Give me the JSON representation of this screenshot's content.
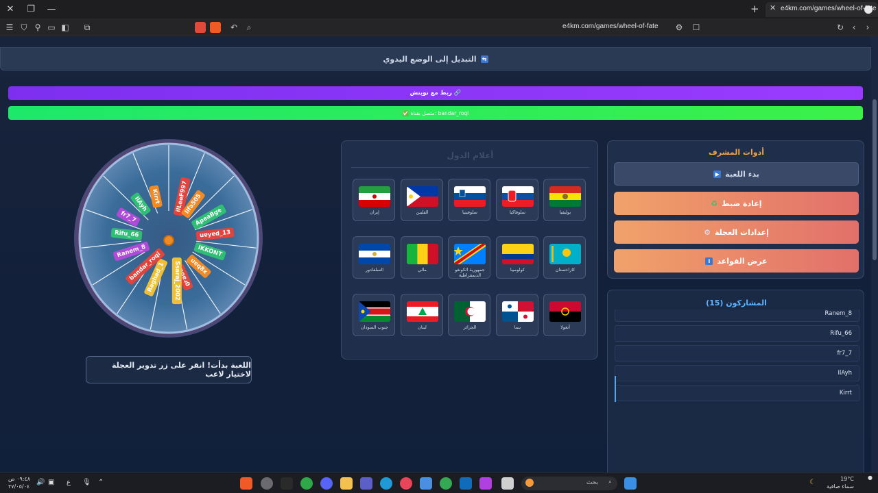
{
  "browser": {
    "tab_title": "e4km.com/games/wheel-of-fate",
    "url": "e4km.com/games/wheel-of-fate"
  },
  "page": {
    "manual_mode_label": "التبديل إلى الوضع اليدوي",
    "twitch_label": "ربط مع تويتش 🔗",
    "connected_label": "✅ متصل بقناة: bandar_roqi",
    "status_text": "اللعبة بدأت! انقر على زر تدوير العجلة لاختيار لاعب"
  },
  "wheel": {
    "names": [
      "ilLeeF997",
      "Ilfa505",
      "ApeaBge",
      "uɐyɐd_13",
      "IKKONT",
      "uɐq8x",
      "noɐɹ0",
      "Ssaraj_2002",
      "Raghad_1",
      "bandar_roqi",
      "Ranem_8",
      "Rifu_66",
      "fr7_7",
      "IlAyh",
      "Kirrt"
    ],
    "center_color": "#f08a24"
  },
  "flags": {
    "title": "أعلام الدول",
    "items": [
      {
        "name": "بوليفيا"
      },
      {
        "name": "سلوفاكيا"
      },
      {
        "name": "سلوفينيا"
      },
      {
        "name": "الفلبين"
      },
      {
        "name": "إيران"
      },
      {
        "name": "كازاخستان"
      },
      {
        "name": "كولومبيا"
      },
      {
        "name": "جمهورية الكونغو الديمقراطية"
      },
      {
        "name": "مالي"
      },
      {
        "name": "السلفادور"
      },
      {
        "name": "أنغولا"
      },
      {
        "name": "بنما"
      },
      {
        "name": "الجزائر"
      },
      {
        "name": "لبنان"
      },
      {
        "name": "جنوب السودان"
      }
    ]
  },
  "admin": {
    "title": "أدوات المشرف",
    "start_label": "بدء اللعبة",
    "reset_label": "إعادة ضبط",
    "wheel_settings_label": "إعدادات العجلة",
    "rules_label": "عرض القواعد"
  },
  "participants": {
    "title": "المشاركون (15)",
    "rows": [
      "Ranem_8",
      "Rifu_66",
      "fr7_7",
      "IlAyh",
      "Kirrt"
    ]
  },
  "taskbar": {
    "search_placeholder": "بحث",
    "temperature": "19°C",
    "weather": "سماء صافية",
    "time": "٠٩:٤٨ ص",
    "date": "٢٧/٠٥/٠٤",
    "lang": "ع"
  }
}
